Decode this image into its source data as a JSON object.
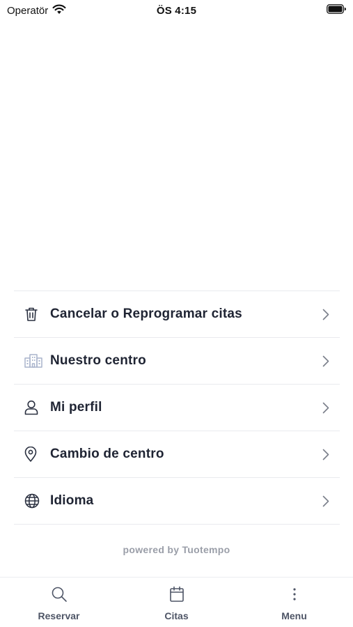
{
  "status_bar": {
    "carrier": "Operatör",
    "time": "ÖS 4:15"
  },
  "menu": {
    "items": [
      {
        "label": "Cancelar o Reprogramar citas",
        "icon": "trash-icon"
      },
      {
        "label": "Nuestro centro",
        "icon": "building-icon"
      },
      {
        "label": "Mi perfil",
        "icon": "user-icon"
      },
      {
        "label": "Cambio de centro",
        "icon": "map-pin-icon"
      },
      {
        "label": "Idioma",
        "icon": "globe-icon"
      }
    ]
  },
  "footer": {
    "powered_by": "powered by Tuotempo"
  },
  "tab_bar": {
    "tabs": [
      {
        "label": "Reservar",
        "icon": "search-icon"
      },
      {
        "label": "Citas",
        "icon": "calendar-icon"
      },
      {
        "label": "Menu",
        "icon": "more-vertical-icon"
      }
    ]
  }
}
